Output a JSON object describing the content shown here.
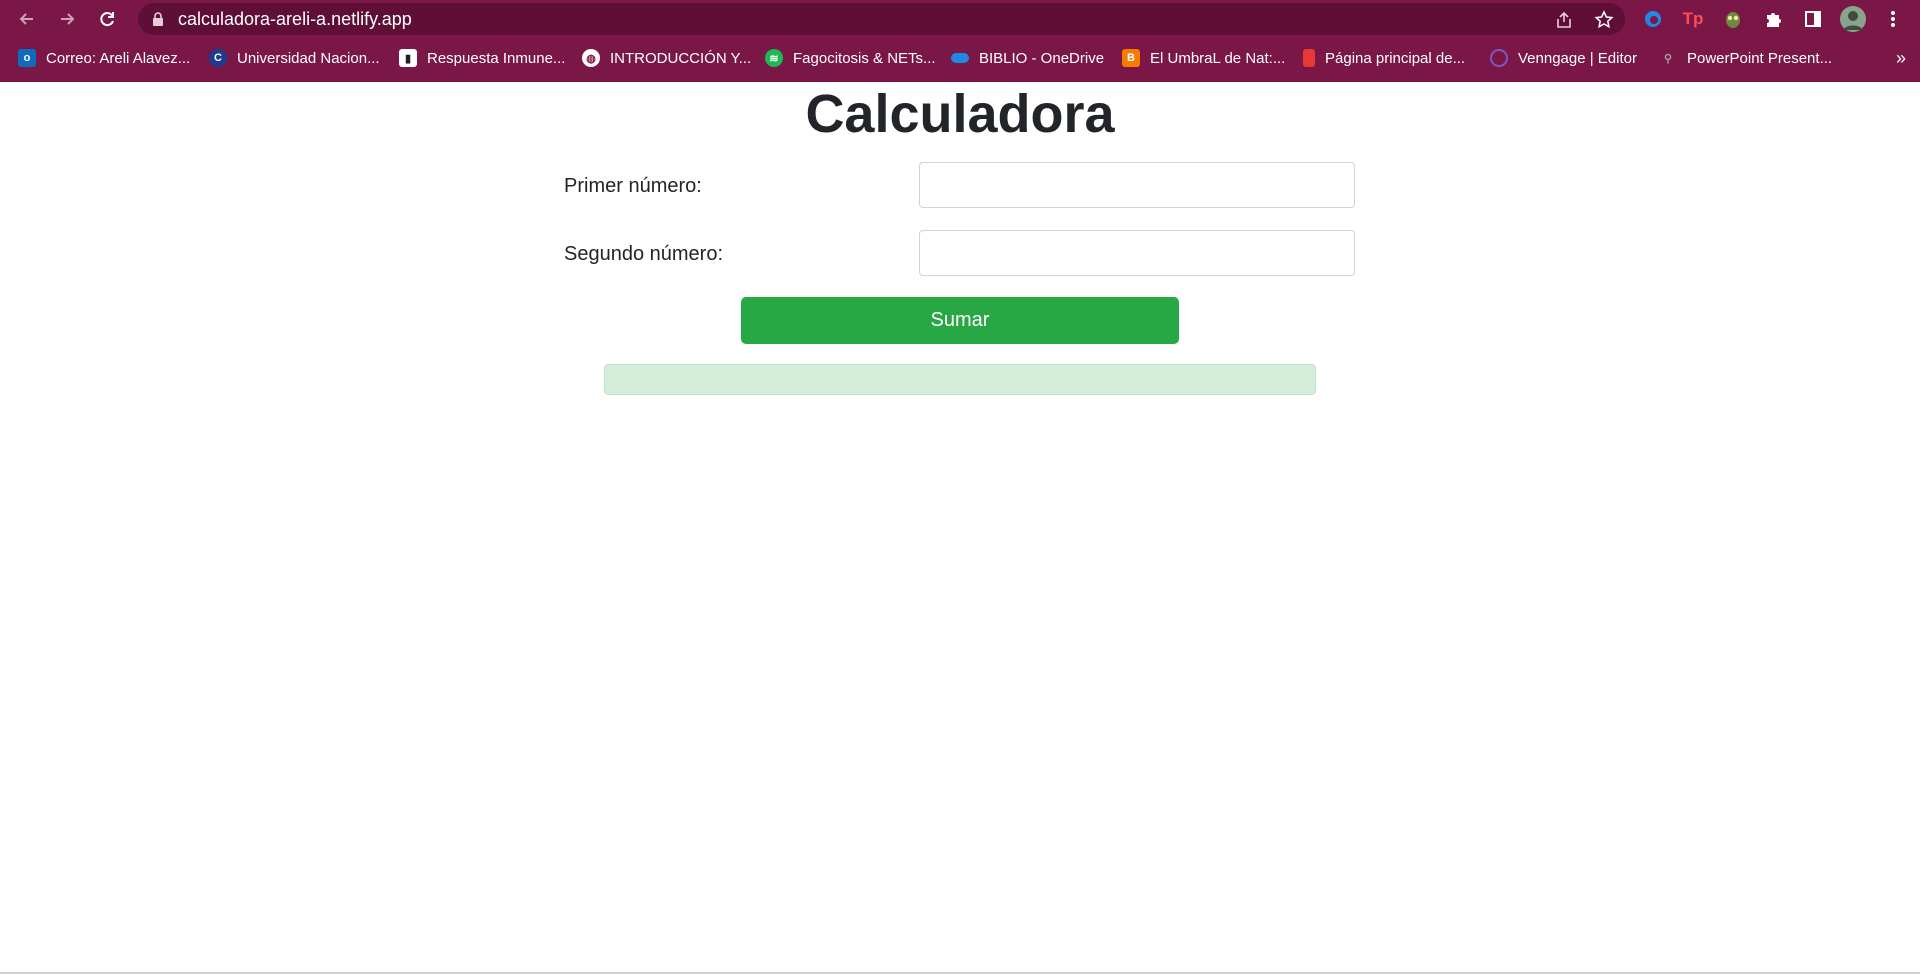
{
  "browser": {
    "url": "calculadora-areli-a.netlify.app",
    "accent": "#7b1747",
    "bookmarks": [
      {
        "label": "Correo: Areli Alavez...",
        "icon": "outlook-icon",
        "color": "#0f6cbd"
      },
      {
        "label": "Universidad Nacion...",
        "icon": "university-c-icon",
        "color": "#1a3d8f"
      },
      {
        "label": "Respuesta Inmune...",
        "icon": "article-icon",
        "color": "#ffffff"
      },
      {
        "label": "INTRODUCCIÓN Y...",
        "icon": "globe-icon",
        "color": "#ffffff"
      },
      {
        "label": "Fagocitosis & NETs...",
        "icon": "spotify-icon",
        "color": "#1db954"
      },
      {
        "label": "BIBLIO - OneDrive",
        "icon": "onedrive-icon",
        "color": "#1e88e5"
      },
      {
        "label": "El UmbraL de Nat:...",
        "icon": "blogger-icon",
        "color": "#f57c00"
      },
      {
        "label": "Página principal de...",
        "icon": "office-icon",
        "color": "#e53935"
      },
      {
        "label": "Venngage | Editor",
        "icon": "venngage-icon",
        "color": "#7e57c2"
      },
      {
        "label": "PowerPoint Present...",
        "icon": "link-icon",
        "color": "#9e9e9e"
      }
    ]
  },
  "app": {
    "title": "Calculadora",
    "first_label": "Primer número:",
    "second_label": "Segundo número:",
    "first_value": "",
    "second_value": "",
    "button_label": "Sumar",
    "result": "",
    "button_color": "#28a745",
    "result_bg": "#d4edda"
  }
}
